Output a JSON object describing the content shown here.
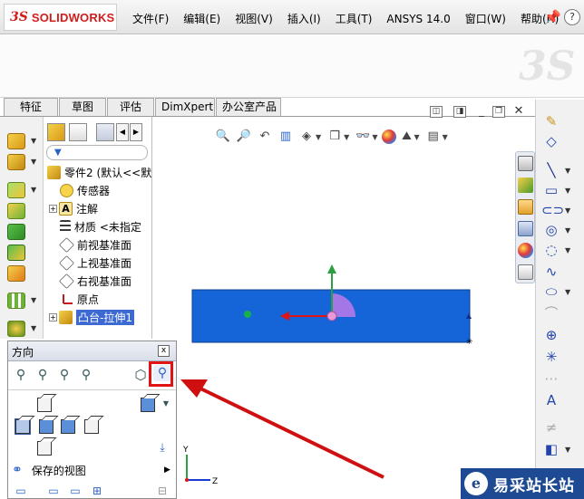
{
  "app": {
    "logo_prefix": "3S",
    "logo_text": "SOLIDWORKS"
  },
  "menu": [
    "文件(F)",
    "编辑(E)",
    "视图(V)",
    "插入(I)",
    "工具(T)",
    "ANSYS 14.0",
    "窗口(W)",
    "帮助(H)"
  ],
  "tabs": [
    "特征",
    "草图",
    "评估",
    "DimXpert",
    "办公室产品"
  ],
  "feature_tree": {
    "root": "零件2 (默认<<默",
    "items": [
      {
        "label": "传感器",
        "icon": "sensor-icon",
        "expandable": false
      },
      {
        "label": "注解",
        "icon": "annotation-icon",
        "expandable": true
      },
      {
        "label": "材质 <未指定",
        "icon": "material-icon",
        "expandable": false
      },
      {
        "label": "前视基准面",
        "icon": "plane-icon",
        "expandable": false
      },
      {
        "label": "上视基准面",
        "icon": "plane-icon",
        "expandable": false
      },
      {
        "label": "右视基准面",
        "icon": "plane-icon",
        "expandable": false
      },
      {
        "label": "原点",
        "icon": "origin-icon",
        "expandable": false
      },
      {
        "label": "凸台-拉伸1",
        "icon": "extrude-icon",
        "expandable": true,
        "selected": true
      }
    ]
  },
  "orientation_panel": {
    "title": "方向",
    "close": "x",
    "saved_views_label": "保存的视图"
  },
  "triad": {
    "y": "Y",
    "z": "Z"
  },
  "watermark": {
    "brand_name": "易采站长站"
  },
  "colors": {
    "model_blue": "#1565d8",
    "selection_blue": "#3c6ad2",
    "highlight_red": "#e01414",
    "arrow_red": "#d01010",
    "logo_red": "#d21c1c"
  }
}
